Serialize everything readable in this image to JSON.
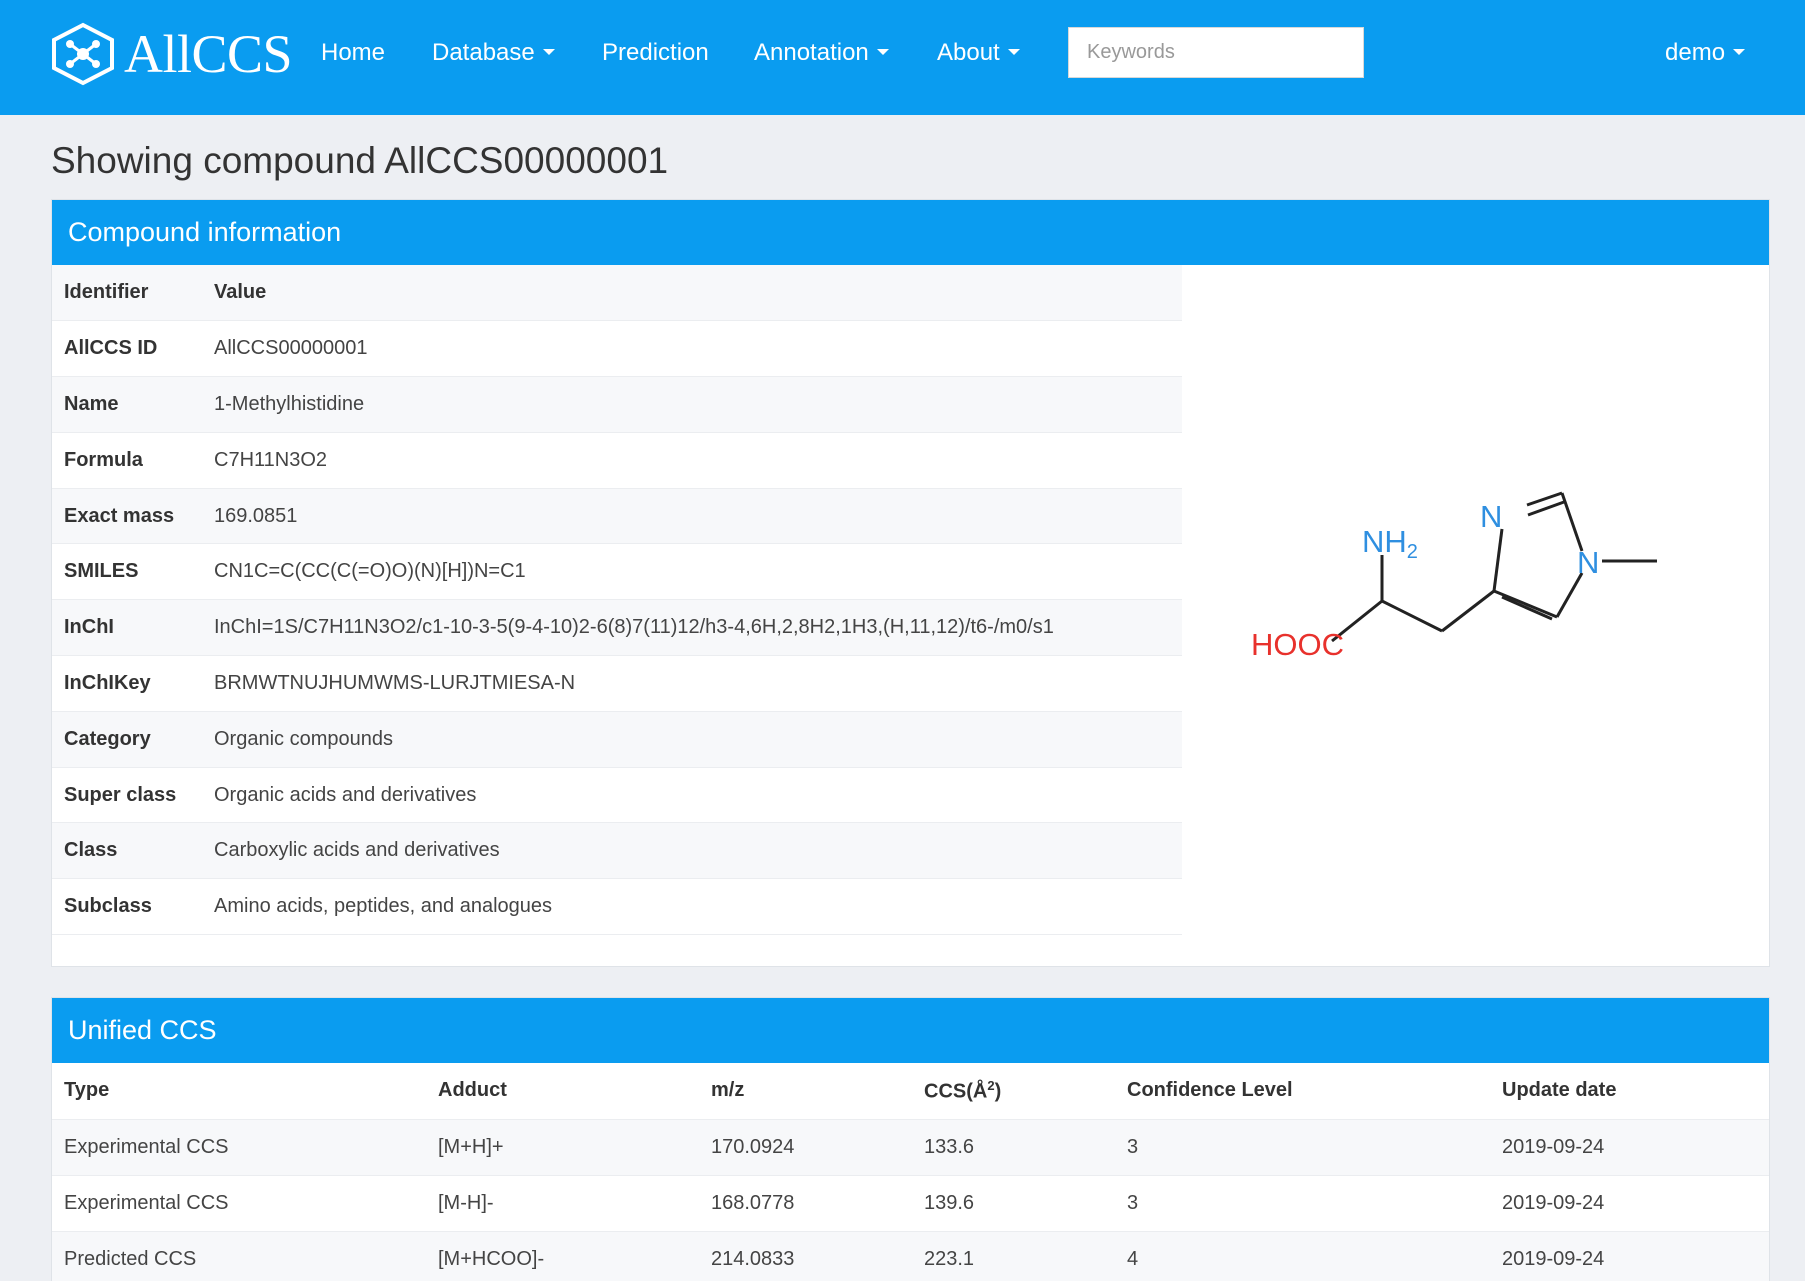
{
  "nav": {
    "brand": "AllCCS",
    "items": [
      {
        "label": "Home",
        "dropdown": false
      },
      {
        "label": "Database",
        "dropdown": true
      },
      {
        "label": "Prediction",
        "dropdown": false
      },
      {
        "label": "Annotation",
        "dropdown": true
      },
      {
        "label": "About",
        "dropdown": true
      }
    ],
    "search_placeholder": "Keywords",
    "user": "demo",
    "accent_color": "#0a9cf0"
  },
  "page_title": "Showing compound AllCCS00000001",
  "compound": {
    "panel_title": "Compound information",
    "header": {
      "key": "Identifier",
      "value": "Value"
    },
    "rows": [
      {
        "key": "AllCCS ID",
        "value": "AllCCS00000001"
      },
      {
        "key": "Name",
        "value": "1-Methylhistidine"
      },
      {
        "key": "Formula",
        "value": "C7H11N3O2"
      },
      {
        "key": "Exact mass",
        "value": "169.0851"
      },
      {
        "key": "SMILES",
        "value": "CN1C=C(CC(C(=O)O)(N)[H])N=C1"
      },
      {
        "key": "InChI",
        "value": "InChI=1S/C7H11N3O2/c1-10-3-5(9-4-10)2-6(8)7(11)12/h3-4,6H,2,8H2,1H3,(H,11,12)/t6-/m0/s1"
      },
      {
        "key": "InChIKey",
        "value": "BRMWTNUJHUMWMS-LURJTMIESA-N"
      },
      {
        "key": "Category",
        "value": "Organic compounds"
      },
      {
        "key": "Super class",
        "value": "Organic acids and derivatives"
      },
      {
        "key": "Class",
        "value": "Carboxylic acids and derivatives"
      },
      {
        "key": "Subclass",
        "value": "Amino acids, peptides, and analogues"
      }
    ],
    "structure_labels": {
      "amine": "NH",
      "amine_sub": "2",
      "acid": "HOOC",
      "n1": "N",
      "n2": "N"
    }
  },
  "ccs": {
    "panel_title": "Unified CCS",
    "headers": {
      "type": "Type",
      "adduct": "Adduct",
      "mz": "m/z",
      "ccs": "CCS(Å",
      "ccs_sup": "2",
      "ccs_close": ")",
      "confidence": "Confidence Level",
      "date": "Update date"
    },
    "rows": [
      {
        "type": "Experimental CCS",
        "adduct": "[M+H]+",
        "mz": "170.0924",
        "ccs": "133.6",
        "confidence": "3",
        "date": "2019-09-24"
      },
      {
        "type": "Experimental CCS",
        "adduct": "[M-H]-",
        "mz": "168.0778",
        "ccs": "139.6",
        "confidence": "3",
        "date": "2019-09-24"
      },
      {
        "type": "Predicted CCS",
        "adduct": "[M+HCOO]-",
        "mz": "214.0833",
        "ccs": "223.1",
        "confidence": "4",
        "date": "2019-09-24"
      }
    ]
  }
}
